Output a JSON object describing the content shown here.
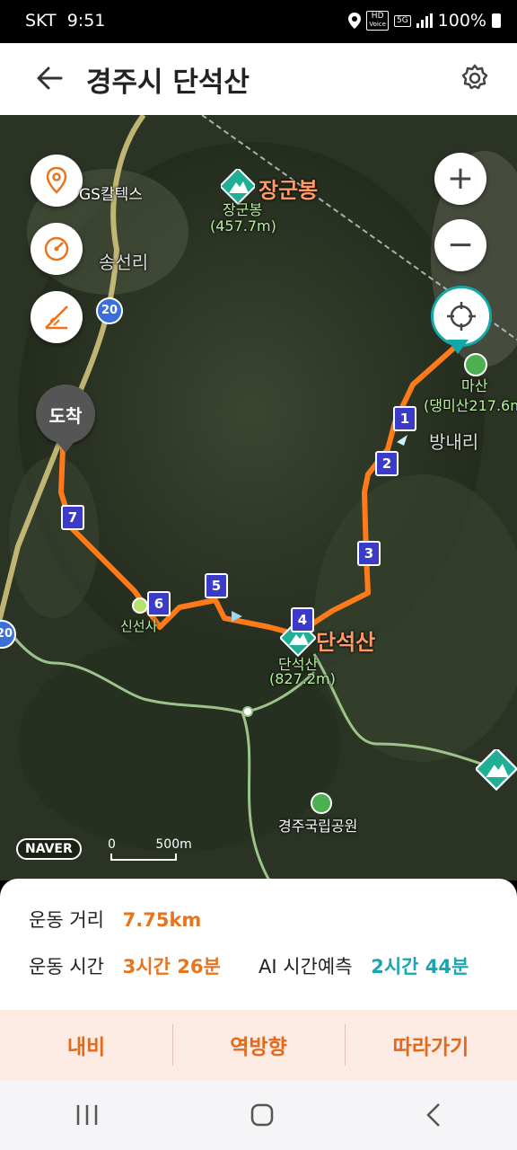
{
  "status": {
    "carrier": "SKT",
    "time": "9:51",
    "hd": "HD",
    "voice": "Voice",
    "network": "5G",
    "battery": "100%"
  },
  "header": {
    "title": "경주시 단석산"
  },
  "map": {
    "labels": {
      "gs": "GS칼텍스",
      "songseonri": "송선리",
      "road20": "20",
      "janggunbong_big": "장군봉",
      "janggunbong_small": "장군봉",
      "janggunbong_height": "(457.7m)",
      "masan": "마산",
      "masan_sub": "(댕미산217.6m",
      "bangnaeri": "방내리",
      "danseoksan_big": "단석산",
      "danseoksan_small": "단석산",
      "danseoksan_height": "(827.2m)",
      "sinseonsa": "신선사",
      "park": "경주국립공원",
      "edge_road": "20",
      "arrival": "도착"
    },
    "markers": [
      "1",
      "2",
      "3",
      "4",
      "5",
      "6",
      "7"
    ],
    "logo": "NAVER",
    "scale_zero": "0",
    "scale_label": "500m",
    "route_color": "#ff7a1a"
  },
  "stats": {
    "distance_label": "운동 거리",
    "distance_value": "7.75km",
    "time_label": "운동 시간",
    "time_value": "3시간 26분",
    "ai_label": "AI 시간예측",
    "ai_value": "2시간 44분"
  },
  "actions": {
    "navi": "내비",
    "reverse": "역방향",
    "follow": "따라가기"
  }
}
